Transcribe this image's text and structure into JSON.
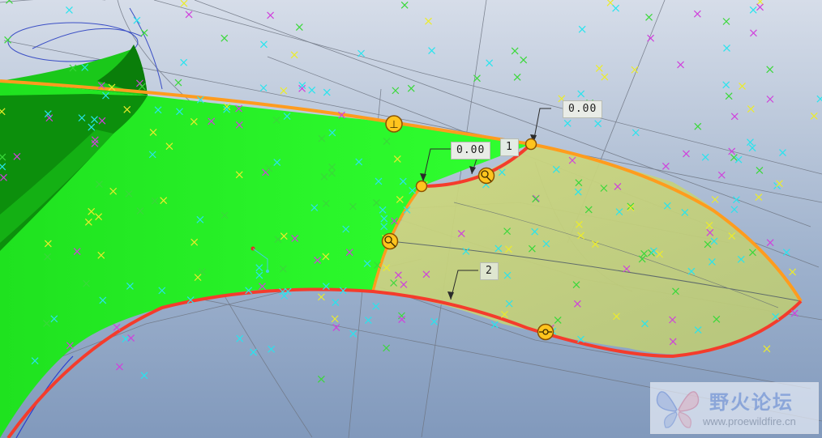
{
  "viewport": {
    "background_top": "#d6dde9",
    "background_bottom": "#8199bc"
  },
  "colors": {
    "surface_green": "#22f022",
    "surface_dark_green": "#0ea00e",
    "blend_patch": "#c2cf7a",
    "edge_orange": "#ff9c1e",
    "edge_red": "#f43c2c",
    "handle_fill": "#ffc41e",
    "handle_stroke": "#8a5200",
    "datum_cyan": "#28e4ee",
    "datum_green": "#3ad83a",
    "datum_magenta": "#d040dc",
    "datum_yellow": "#ecec2a"
  },
  "dimensions": {
    "top_right": "0.00",
    "top_left": "0.00",
    "top_middle": "1",
    "bottom": "2"
  },
  "constraint_symbol": "⊥",
  "watermark": {
    "title": "野火论坛",
    "url": "www.proewildfire.cn"
  }
}
